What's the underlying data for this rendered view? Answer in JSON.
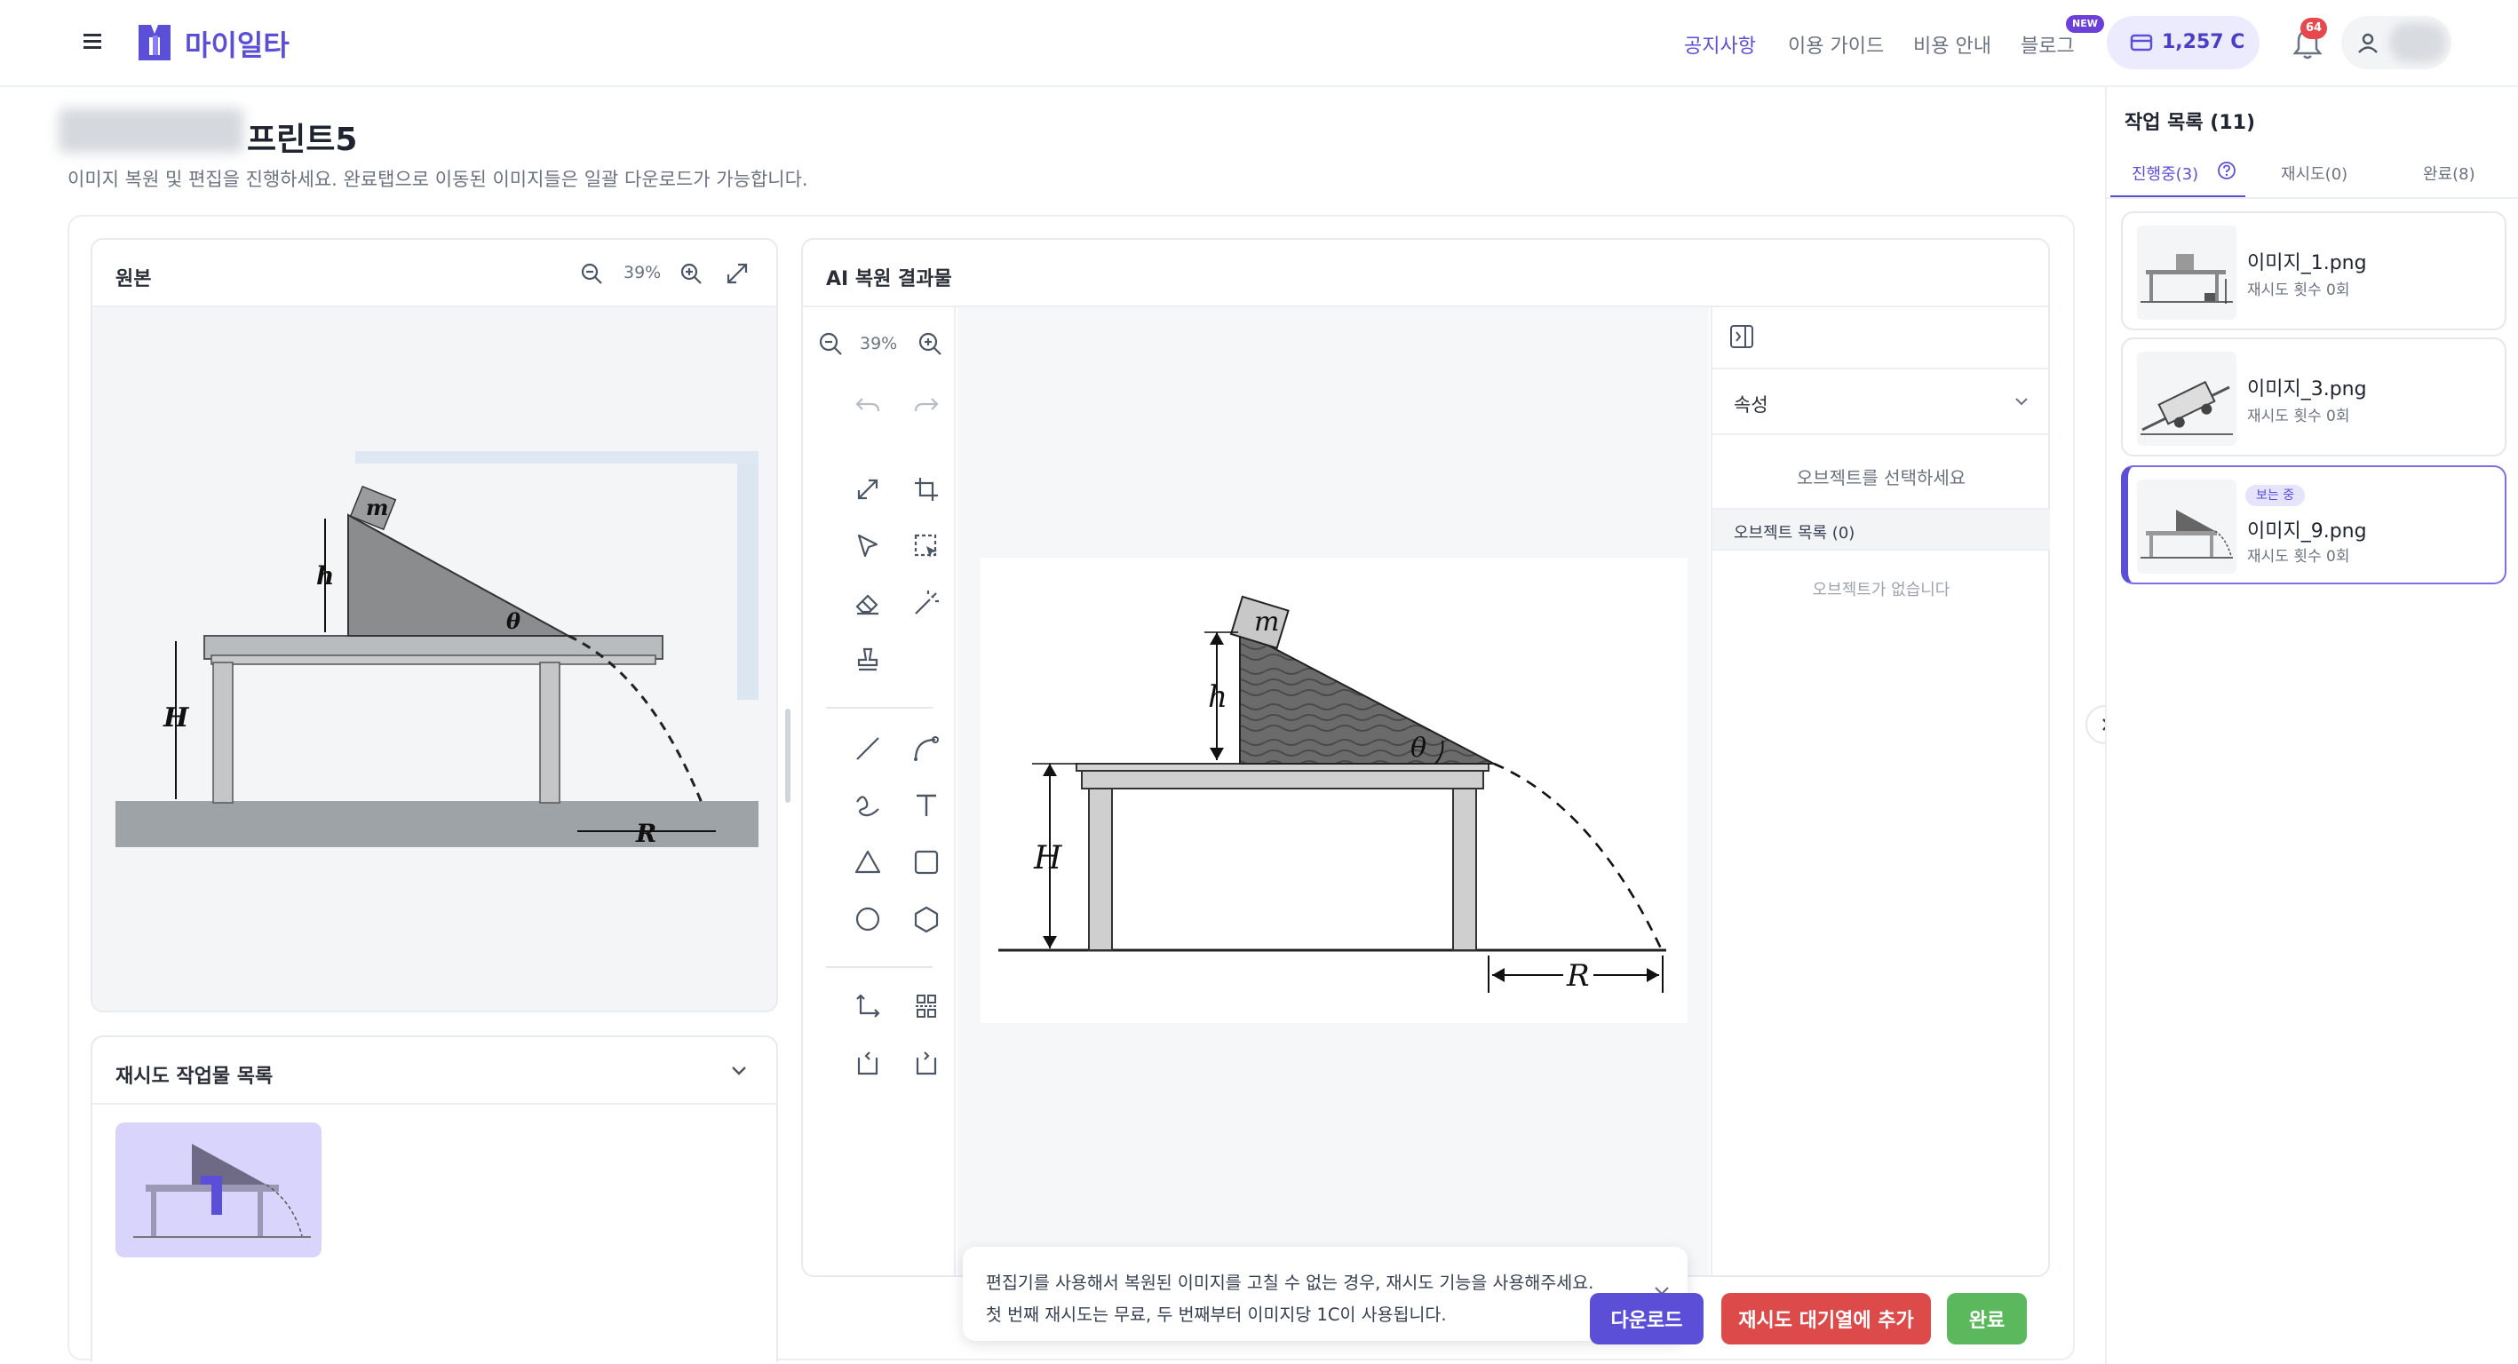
{
  "header": {
    "logo_text": "마이일타",
    "nav": [
      "공지사항",
      "이용 가이드",
      "비용 안내",
      "블로그"
    ],
    "blog_badge": "NEW",
    "credits": "1,257 C",
    "notification_count": "64",
    "accent_color": "#5b4fd8"
  },
  "page": {
    "title_visible": "프린트5",
    "subtitle": "이미지 복원 및 편집을 진행하세요. 완료탭으로 이동된 이미지들은 일괄 다운로드가 가능합니다."
  },
  "original": {
    "title": "원본",
    "zoom": "39%"
  },
  "retry_list": {
    "title": "재시도 작업물 목록"
  },
  "result": {
    "title": "AI 복원 결과물",
    "zoom": "39%"
  },
  "diagram": {
    "labels": {
      "mass": "m",
      "small_height": "h",
      "angle": "θ",
      "big_height": "H",
      "range": "R"
    }
  },
  "properties": {
    "section_title": "속성",
    "select_prompt": "오브젝트를 선택하세요",
    "object_list_title": "오브젝트 목록 (0)",
    "empty_text": "오브젝트가 없습니다"
  },
  "toast": {
    "line1": "편집기를 사용해서 복원된 이미지를 고칠 수 없는 경우, 재시도 기능을 사용해주세요.",
    "line2": "첫 번째 재시도는 무료, 두 번째부터 이미지당 1C이 사용됩니다."
  },
  "actions": {
    "download": "다운로드",
    "retry_queue": "재시도 대기열에 추가",
    "done": "완료",
    "colors": {
      "download": "#5b4fd8",
      "retry": "#dc4a4a",
      "done": "#5cb85c"
    }
  },
  "jobs": {
    "title": "작업 목록 (11)",
    "tabs": [
      "진행중(3)",
      "재시도(0)",
      "완료(8)"
    ],
    "items": [
      {
        "name": "이미지_1.png",
        "retries": "재시도 횟수 0회",
        "badge": ""
      },
      {
        "name": "이미지_3.png",
        "retries": "재시도 횟수 0회",
        "badge": ""
      },
      {
        "name": "이미지_9.png",
        "retries": "재시도 횟수 0회",
        "badge": "보는 중"
      }
    ]
  }
}
